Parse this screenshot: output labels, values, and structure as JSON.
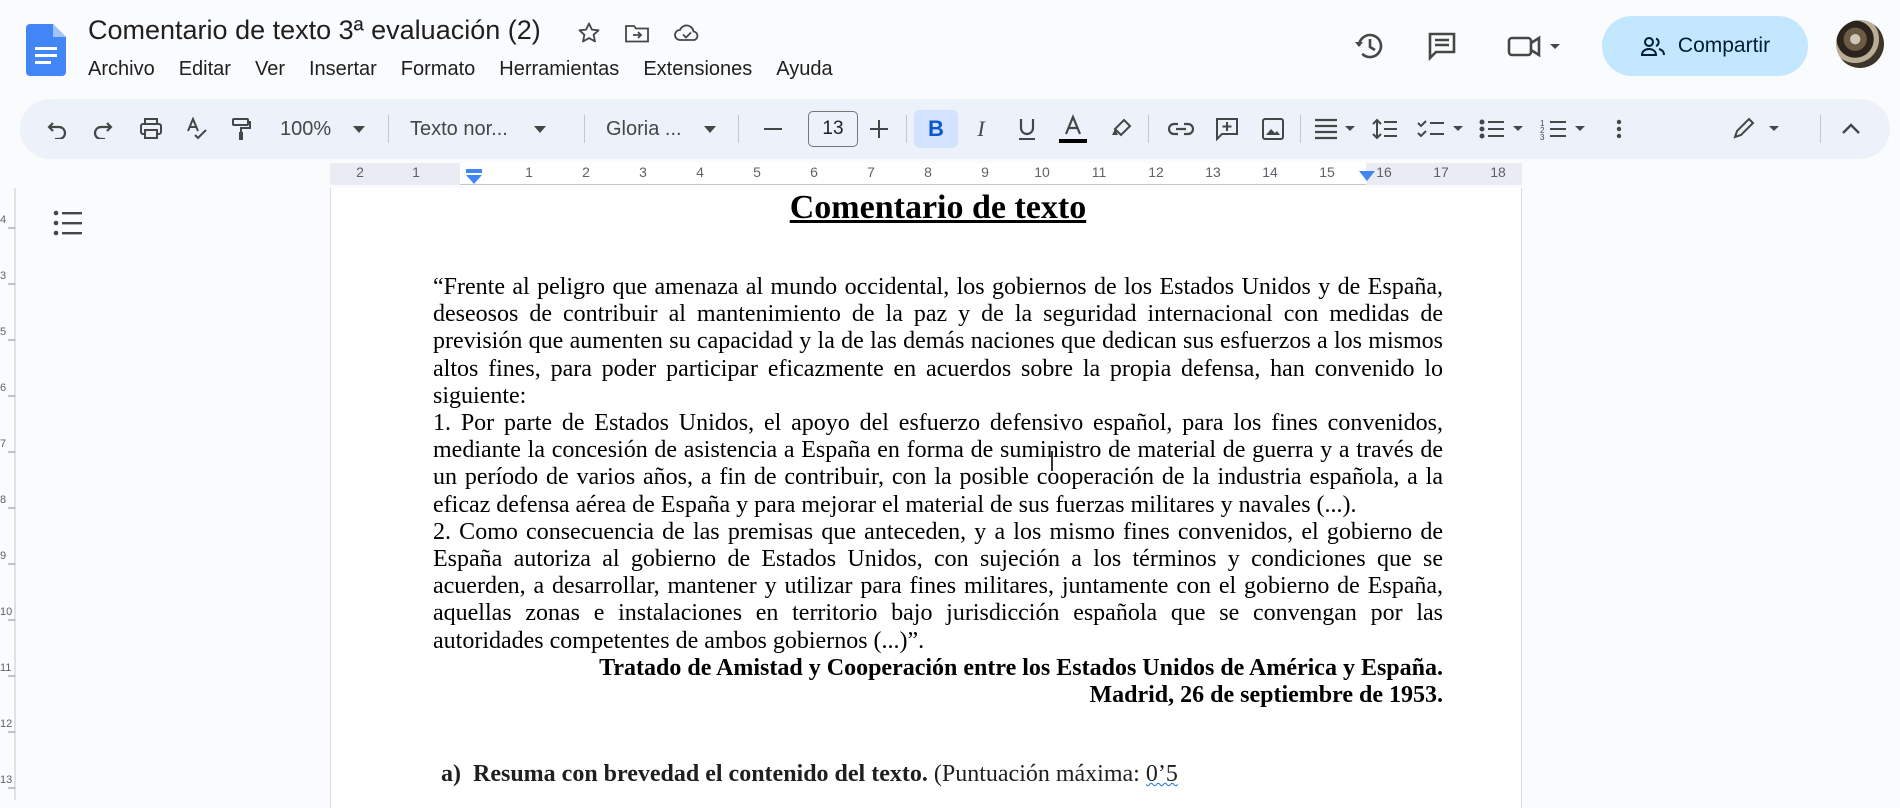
{
  "app": {
    "doc_title": "Comentario de texto 3ª evaluación (2)",
    "menu": [
      "Archivo",
      "Editar",
      "Ver",
      "Insertar",
      "Formato",
      "Herramientas",
      "Extensiones",
      "Ayuda"
    ],
    "share_label": "Compartir",
    "brand_color": "#4285f4",
    "share_bg": "#c2e7ff"
  },
  "toolbar": {
    "zoom": "100%",
    "style": "Texto nor...",
    "font": "Gloria ...",
    "font_size": "13",
    "icons": [
      "undo-icon",
      "redo-icon",
      "print-icon",
      "spellcheck-icon",
      "paint-format-icon",
      "bold-icon",
      "italic-icon",
      "underline-icon",
      "text-color-icon",
      "highlight-icon",
      "link-icon",
      "comment-icon",
      "image-icon",
      "align-icon",
      "line-spacing-icon",
      "checklist-icon",
      "bullet-list-icon",
      "numbered-list-icon",
      "more-icon",
      "edit-mode-icon",
      "collapse-icon"
    ]
  },
  "ruler": {
    "labels": [
      "2",
      "1",
      "1",
      "2",
      "3",
      "4",
      "5",
      "6",
      "7",
      "8",
      "9",
      "10",
      "11",
      "12",
      "13",
      "14",
      "15",
      "16",
      "17",
      "18"
    ],
    "vertical_labels": [
      "4",
      "3",
      "5",
      "6",
      "7",
      "8",
      "9",
      "10",
      "11",
      "12",
      "13",
      "14"
    ]
  },
  "document": {
    "heading": "Comentario de texto",
    "paragraphs": [
      "“Frente al peligro que amenaza al mundo occidental, los gobiernos de los Estados Unidos y de España, deseosos de contribuir al mantenimiento de la paz y de la seguridad internacional con medidas de previsión que aumenten su capacidad y la de las demás naciones que dedican sus esfuerzos a los mismos altos fines, para poder participar eficazmente en acuerdos sobre la propia defensa, han convenido lo siguiente:",
      "1. Por parte de Estados Unidos, el apoyo del esfuerzo defensivo español, para los fines convenidos, mediante la concesión de asistencia a España en forma de suministro de material de guerra y a través de un período de varios años, a fin de contribuir, con la posible cooperación de la industria española, a la eficaz defensa aérea de España y para mejorar el material de sus fuerzas militares y navales (...).",
      "2. Como consecuencia de las premisas que anteceden, y a los mismo fines convenidos, el gobierno de España autoriza al gobierno de Estados Unidos, con sujeción a los términos y condiciones que se acuerden, a desarrollar, mantener y utilizar para fines militares, juntamente con el gobierno de España, aquellas zonas e instalaciones en territorio bajo jurisdicción española que se convengan por las autoridades competentes de ambos gobiernos (...)”."
    ],
    "source_line1": "Tratado de Amistad y Cooperación entre los Estados Unidos de América y España.",
    "source_line2": "Madrid, 26 de septiembre de 1953.",
    "question_label": "a)",
    "question_bold": "Resuma con brevedad el contenido del texto.",
    "question_rest": "(Puntuación máxima: ",
    "question_score": "0’5"
  }
}
